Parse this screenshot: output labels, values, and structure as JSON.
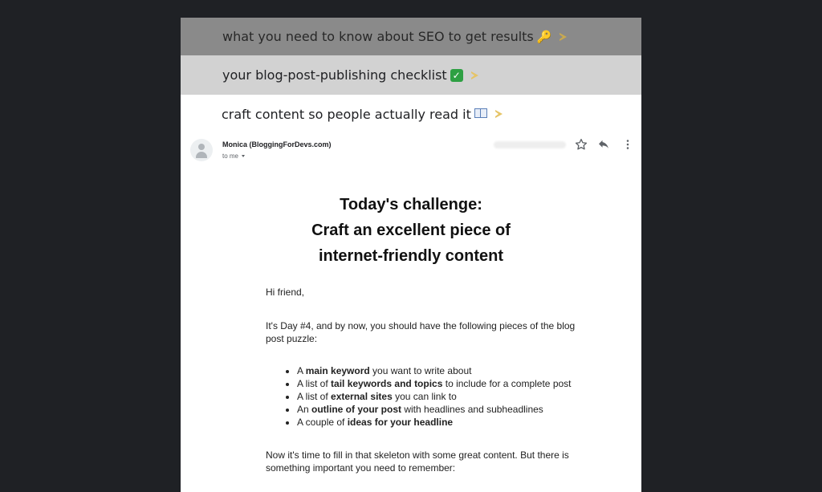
{
  "threads": [
    {
      "subject": "what you need to know about SEO to get results",
      "emoji": "key-emoji"
    },
    {
      "subject": "your blog-post-publishing checklist",
      "emoji": "check-mark-button-emoji"
    },
    {
      "subject": "craft content so people actually read it",
      "emoji": "open-book-emoji"
    }
  ],
  "message": {
    "sender": "Monica (BloggingForDevs.com)",
    "recipient": "to me",
    "headline": [
      "Today's challenge:",
      "Craft an excellent piece of",
      "internet-friendly content"
    ],
    "greeting": "Hi friend,",
    "intro": "It's Day #4, and by now, you should have the following pieces of the blog post puzzle:",
    "checklist": [
      {
        "before": "A ",
        "bold": "main keyword",
        "after": " you want to write about"
      },
      {
        "before": "A list of ",
        "bold": "tail keywords and topics",
        "after": " to include for a complete post"
      },
      {
        "before": "A list of ",
        "bold": "external sites",
        "after": " you can link to"
      },
      {
        "before": "An ",
        "bold": "outline of your post",
        "after": " with headlines and subheadlines"
      },
      {
        "before": "A couple of ",
        "bold": "ideas for your headline",
        "after": ""
      }
    ],
    "closing": "Now it's time to fill in that skeleton with some great content. But there is something important you need to remember:"
  },
  "colors": {
    "page_bg": "#1f2125",
    "importance_marker": "#e6c466",
    "selected_row": "#8a8a8a",
    "hover_row": "#d2d2d2"
  }
}
